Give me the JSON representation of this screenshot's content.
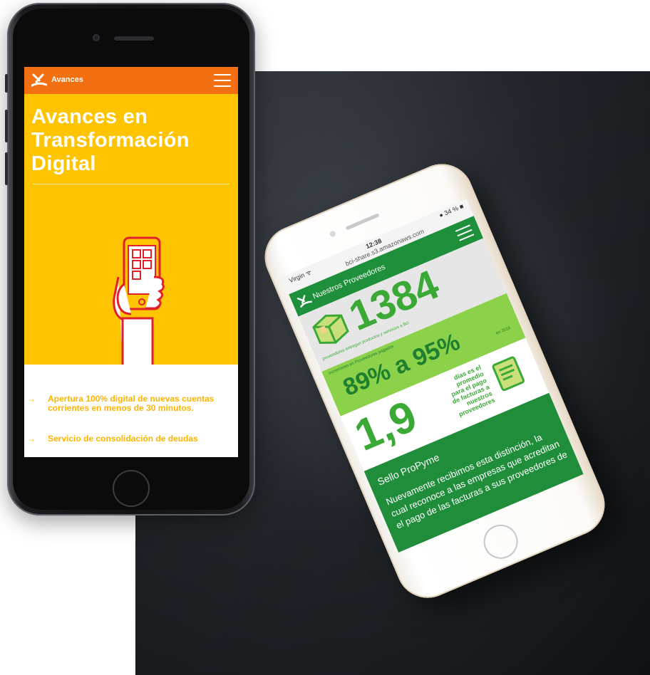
{
  "left_phone": {
    "app_title": "Avances",
    "hero_title_lines": [
      "Avances en",
      "Transformación",
      "Digital"
    ],
    "bullets": [
      {
        "arrow": "→",
        "text": "Apertura 100% digital de nuevas cuentas corrientes en menos de 30 minutos."
      },
      {
        "arrow": "→",
        "text": "Servicio de consolidación de deudas"
      }
    ],
    "colors": {
      "header": "#f26f12",
      "hero": "#ffc400",
      "accent": "#ffb400"
    },
    "icons": [
      "logo-icon",
      "hamburger-menu-icon",
      "hand-phone-illustration"
    ]
  },
  "right_phone": {
    "status": {
      "carrier": "Virgin ᯤ",
      "time": "12:38",
      "url": "bci-share.s3.amazonaws.com",
      "battery": "● 34 % ■"
    },
    "nav_title": "Nuestros Proveedores",
    "stat_count": "1384",
    "stat_count_note": "proveedores entregan productos y servicios a Bci",
    "stat_pct_label": "Incremento en Proveedores pagados",
    "stat_pct": "89% a 95%",
    "stat_pct_year": "en 2016",
    "stat_days": "1,9",
    "stat_days_caption_lines": [
      "días es el",
      "promedio",
      "para el pago",
      "de facturas a",
      "nuestros",
      "proveedores"
    ],
    "sello_title": "Sello ProPyme",
    "sello_body": "Nuevamente recibimos esta distinción, la cual reconoce a las empresas que acreditan el pago de las facturas a sus proveedores de",
    "colors": {
      "green_dark": "#1f8d3a",
      "green_light": "#8bd14a",
      "green_text": "#3aa935"
    },
    "icons": [
      "box-icon",
      "document-icon",
      "hamburger-menu-icon",
      "logo-icon"
    ]
  }
}
